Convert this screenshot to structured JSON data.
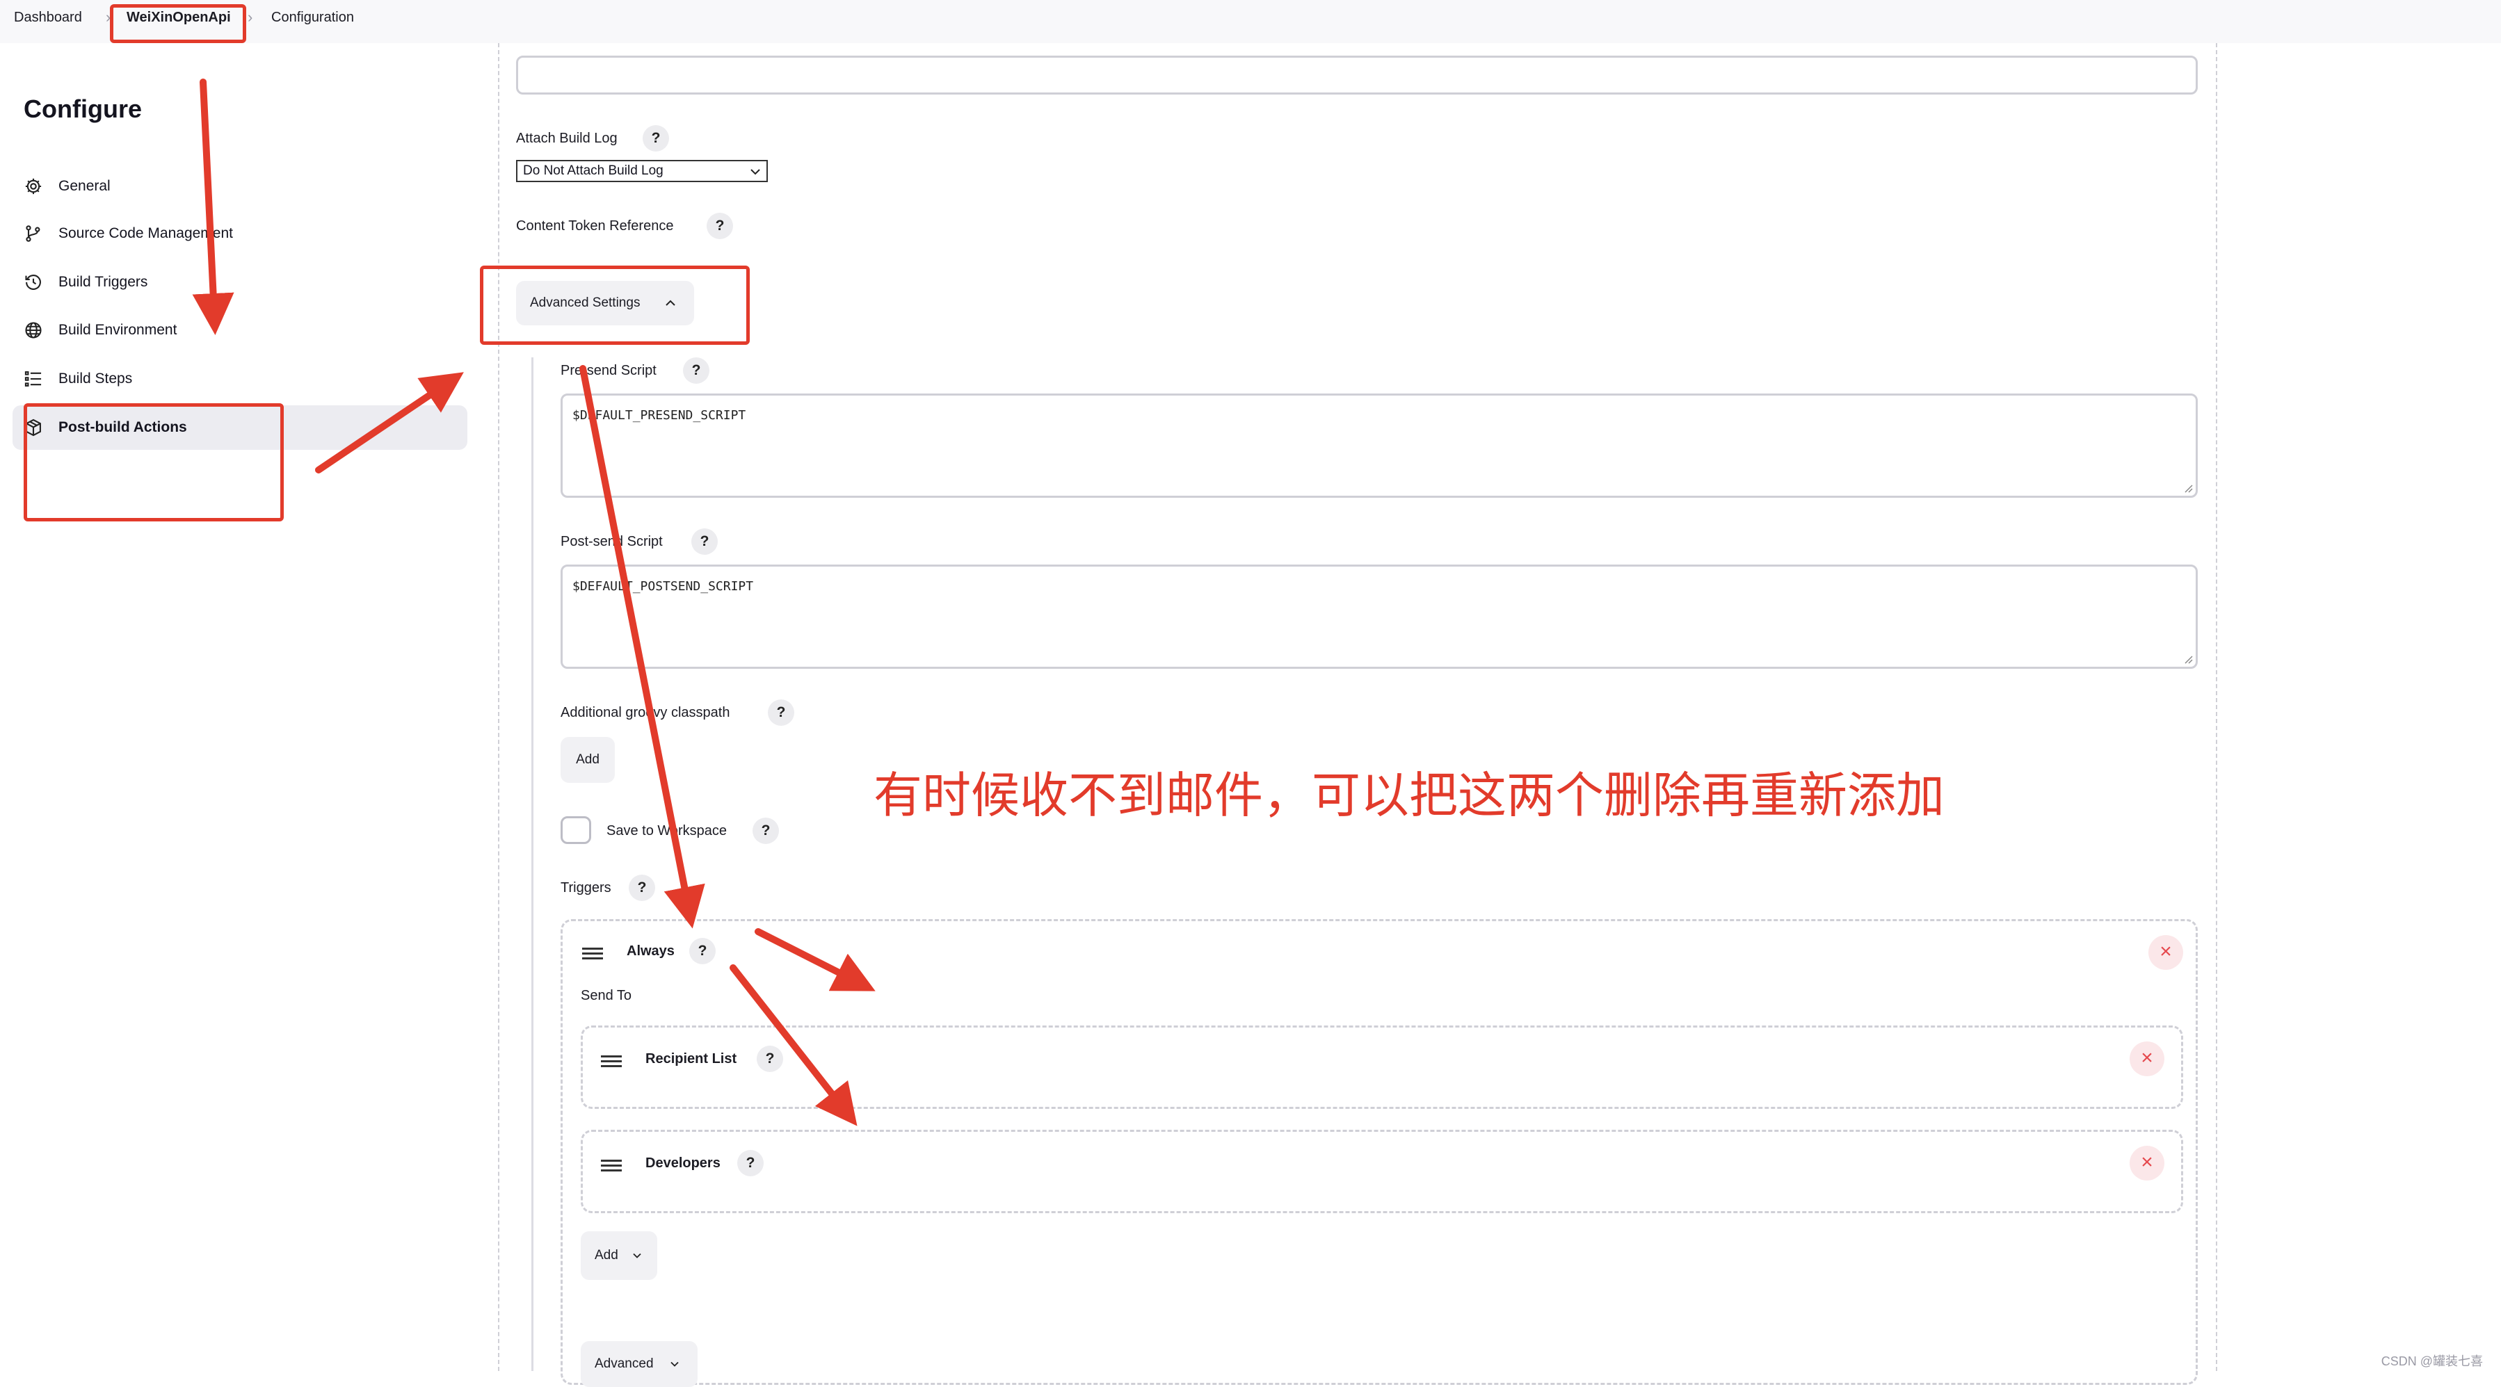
{
  "breadcrumb": {
    "items": [
      "Dashboard",
      "WeiXinOpenApi",
      "Configuration"
    ],
    "separator": "›"
  },
  "sidebar": {
    "title": "Configure",
    "items": [
      {
        "label": "General",
        "icon": "gear-icon"
      },
      {
        "label": "Source Code Management",
        "icon": "branch-icon"
      },
      {
        "label": "Build Triggers",
        "icon": "clock-icon"
      },
      {
        "label": "Build Environment",
        "icon": "globe-icon"
      },
      {
        "label": "Build Steps",
        "icon": "list-icon"
      },
      {
        "label": "Post-build Actions",
        "icon": "cube-icon",
        "active": true
      }
    ]
  },
  "form": {
    "attach_build_log": {
      "label": "Attach Build Log",
      "selected": "Do Not Attach Build Log"
    },
    "content_token_reference": {
      "label": "Content Token Reference"
    },
    "advanced_settings": {
      "label": "Advanced Settings"
    },
    "presend_script": {
      "label": "Pre-send Script",
      "value": "$DEFAULT_PRESEND_SCRIPT"
    },
    "postsend_script": {
      "label": "Post-send Script",
      "value": "$DEFAULT_POSTSEND_SCRIPT"
    },
    "groovy_classpath": {
      "label": "Additional groovy classpath",
      "add_label": "Add"
    },
    "save_to_workspace": {
      "label": "Save to Workspace",
      "checked": false
    },
    "triggers": {
      "label": "Triggers",
      "items": [
        {
          "name": "Always",
          "send_to_label": "Send To",
          "recipients": [
            "Recipient List",
            "Developers"
          ],
          "add_label": "Add",
          "advanced_label": "Advanced"
        }
      ]
    },
    "help_glyph": "?",
    "remove_glyph": "×"
  },
  "annotation": {
    "text": "有时候收不到邮件，可以把这两个删除再重新添加",
    "color": "#e23b2b"
  },
  "watermark": "CSDN @罐装七喜",
  "colors": {
    "accent_red": "#e23b2b",
    "remove_red": "#e5484d",
    "active_nav_bg": "#ececf1"
  }
}
